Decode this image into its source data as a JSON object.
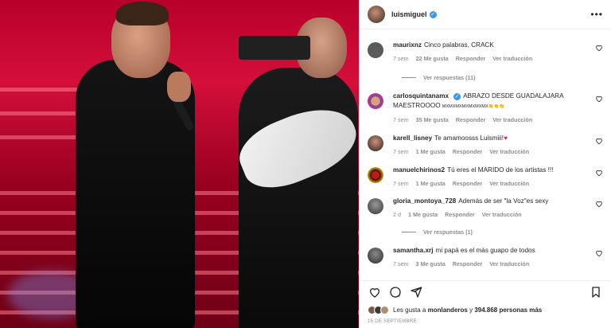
{
  "post": {
    "username": "luismiguel",
    "verified_icon": "verified-badge-icon",
    "more_icon": "more-options-icon"
  },
  "comments": [
    {
      "user": "maurixnz",
      "text": "Cinco palabras, CRACK",
      "time": "7 sem",
      "likes": "22 Me gusta",
      "reply": "Responder",
      "translate": "Ver traducción",
      "avatar_color": "#5a5a5a"
    },
    {
      "user": "carlosquintanamx",
      "text": "ABRAZO DESDE GUADALAJARA MAESTROOOO",
      "extra": "MXMXMXMXMXMXMX👏👏👏",
      "time": "7 sem",
      "likes": "35 Me gusta",
      "reply": "Responder",
      "translate": "Ver traducción",
      "avatar_color": "#6b4e9c"
    },
    {
      "user": "karell_lisney",
      "text": "Te amamoosss Luismiii!",
      "emoji": "♥",
      "time": "7 sem",
      "likes": "1 Me gusta",
      "reply": "Responder",
      "translate": "Ver traducción",
      "avatar_color": "#3c2a25"
    },
    {
      "user": "manuelchirinos2",
      "text": "Tú eres el MARIDO de los artistas !!!",
      "time": "7 sem",
      "likes": "1 Me gusta",
      "reply": "Responder",
      "translate": "Ver traducción",
      "avatar_color": "#8a0f0f"
    },
    {
      "user": "gloria_montoya_728",
      "text": "Además de ser \"la Voz\"es sexy",
      "time": "2 d",
      "likes": "1 Me gusta",
      "reply": "Responder",
      "translate": "Ver traducción",
      "avatar_color": "#4a4a4a"
    },
    {
      "user": "samantha.xrj",
      "text": "mi papá es el más guapo de todos",
      "time": "7 sem",
      "likes": "3 Me gusta",
      "reply": "Responder",
      "translate": "Ver traducción",
      "avatar_color": "#555555"
    }
  ],
  "replies": [
    {
      "label": "Ver respuestas (11)"
    },
    {
      "label": "Ver respuestas (1)"
    }
  ],
  "footer": {
    "likes_prefix": "Les gusta a",
    "likes_user": "monlanderos",
    "likes_mid": "y",
    "likes_count": "394.868 personas más",
    "date": "15 DE SEPTIEMBRE"
  },
  "colors": {
    "verified": "#3897f0",
    "heart_red": "#e0245e",
    "meta": "#8e8e8e"
  }
}
